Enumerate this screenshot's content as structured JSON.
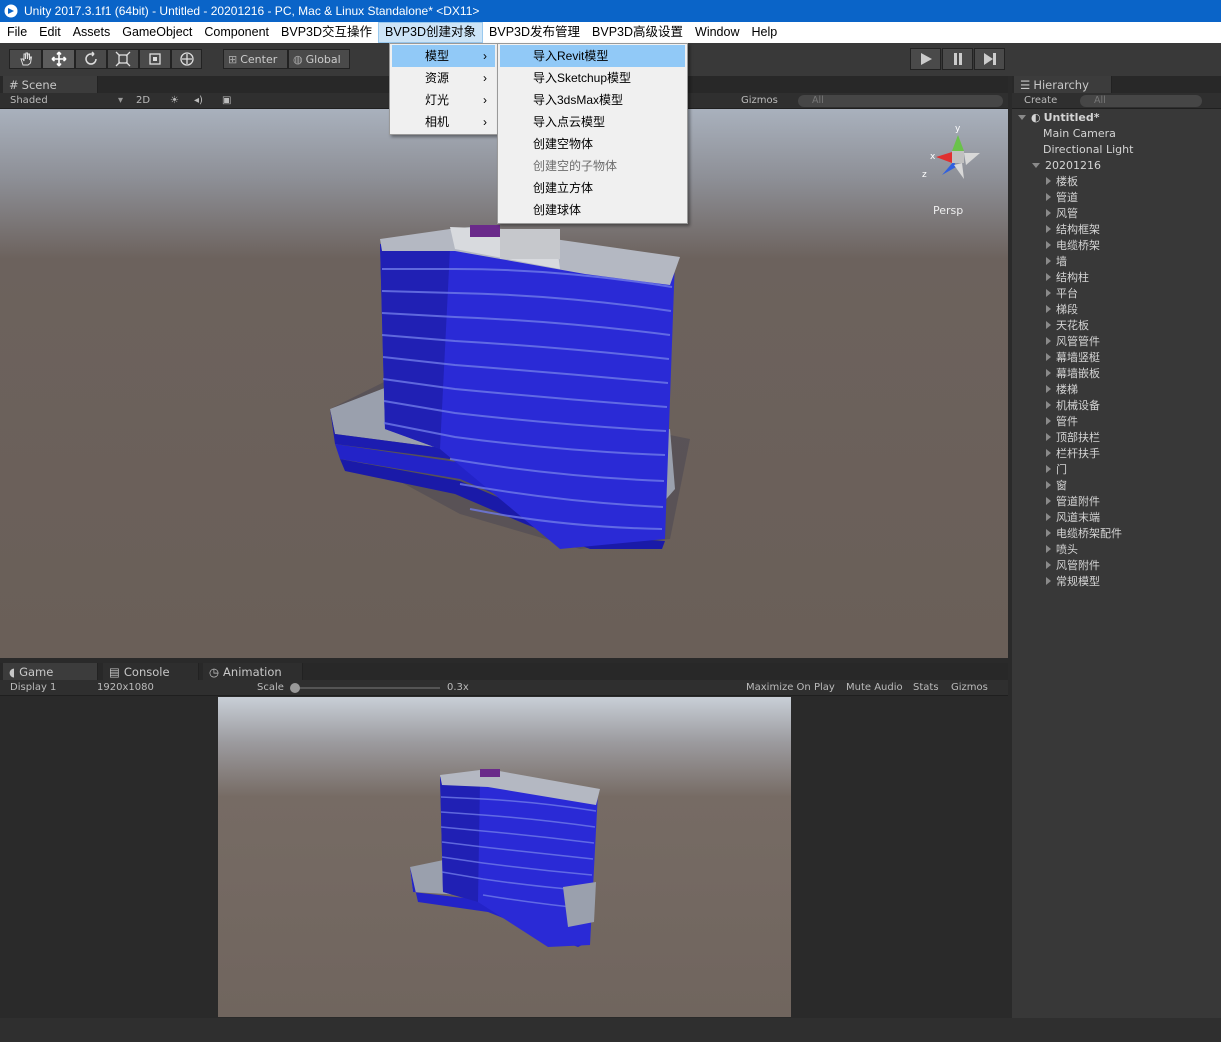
{
  "window": {
    "title": "Unity 2017.3.1f1 (64bit) - Untitled - 20201216 - PC, Mac & Linux Standalone* <DX11>"
  },
  "menubar": {
    "items": [
      "File",
      "Edit",
      "Assets",
      "GameObject",
      "Component",
      "BVP3D交互操作",
      "BVP3D创建对象",
      "BVP3D发布管理",
      "BVP3D高级设置",
      "Window",
      "Help"
    ]
  },
  "toolbar": {
    "center_label": "Center",
    "global_label": "Global"
  },
  "scene": {
    "tab_label": "Scene",
    "shading": "Shaded",
    "mode_2d": "2D",
    "gizmos": "Gizmos",
    "search_placeholder": "All",
    "persp": "Persp",
    "axis_x": "x",
    "axis_y": "y",
    "axis_z": "z"
  },
  "hierarchy": {
    "tab_label": "Hierarchy",
    "create_label": "Create",
    "search_placeholder": "All",
    "scene_name": "Untitled*",
    "items": [
      "Main Camera",
      "Directional Light"
    ],
    "group": "20201216",
    "children": [
      "楼板",
      "管道",
      "风管",
      "结构框架",
      "电缆桥架",
      "墙",
      "结构柱",
      "平台",
      "梯段",
      "天花板",
      "风管管件",
      "幕墙竖梃",
      "幕墙嵌板",
      "楼梯",
      "机械设备",
      "管件",
      "顶部扶栏",
      "栏杆扶手",
      "门",
      "窗",
      "管道附件",
      "风道末端",
      "电缆桥架配件",
      "喷头",
      "风管附件",
      "常规模型"
    ]
  },
  "bottom": {
    "tabs": [
      "Game",
      "Console",
      "Animation"
    ],
    "display": "Display 1",
    "resolution": "1920x1080",
    "scale_label": "Scale",
    "scale_value": "0.3x",
    "maximize": "Maximize On Play",
    "mute": "Mute Audio",
    "stats": "Stats",
    "gizmos": "Gizmos"
  },
  "menu_main": {
    "items": [
      "模型",
      "资源",
      "灯光",
      "相机"
    ]
  },
  "menu_sub": {
    "items": [
      "导入Revit模型",
      "导入Sketchup模型",
      "导入3dsMax模型",
      "导入点云模型",
      "创建空物体",
      "创建空的子物体",
      "创建立方体",
      "创建球体"
    ]
  },
  "colors": {
    "title_bar": "#0a64c8",
    "menu_highlight": "#91c9f7",
    "building_blue": "#2020c8",
    "panel": "#383838"
  }
}
